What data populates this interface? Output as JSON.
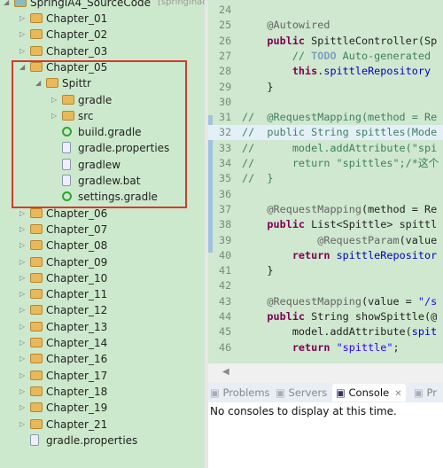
{
  "tree": {
    "root": "SpringIA4_SourceCode",
    "root_suffix": "[springinacti",
    "items": [
      {
        "label": "Chapter_01",
        "level": 1,
        "type": "folder",
        "state": "collapsed"
      },
      {
        "label": "Chapter_02",
        "level": 1,
        "type": "folder",
        "state": "collapsed"
      },
      {
        "label": "Chapter_03",
        "level": 1,
        "type": "folder",
        "state": "collapsed"
      },
      {
        "label": "Chapter_05",
        "level": 1,
        "type": "folder",
        "state": "expanded"
      },
      {
        "label": "Spittr",
        "level": 2,
        "type": "folder",
        "state": "expanded"
      },
      {
        "label": "gradle",
        "level": 3,
        "type": "folder",
        "state": "collapsed"
      },
      {
        "label": "src",
        "level": 3,
        "type": "folder",
        "state": "collapsed"
      },
      {
        "label": "build.gradle",
        "level": 3,
        "type": "gradle"
      },
      {
        "label": "gradle.properties",
        "level": 3,
        "type": "file"
      },
      {
        "label": "gradlew",
        "level": 3,
        "type": "file"
      },
      {
        "label": "gradlew.bat",
        "level": 3,
        "type": "file"
      },
      {
        "label": "settings.gradle",
        "level": 3,
        "type": "gradle"
      },
      {
        "label": "Chapter_06",
        "level": 1,
        "type": "folder",
        "state": "collapsed"
      },
      {
        "label": "Chapter_07",
        "level": 1,
        "type": "folder",
        "state": "collapsed"
      },
      {
        "label": "Chapter_08",
        "level": 1,
        "type": "folder",
        "state": "collapsed"
      },
      {
        "label": "Chapter_09",
        "level": 1,
        "type": "folder",
        "state": "collapsed"
      },
      {
        "label": "Chapter_10",
        "level": 1,
        "type": "folder",
        "state": "collapsed"
      },
      {
        "label": "Chapter_11",
        "level": 1,
        "type": "folder",
        "state": "collapsed"
      },
      {
        "label": "Chapter_12",
        "level": 1,
        "type": "folder",
        "state": "collapsed"
      },
      {
        "label": "Chapter_13",
        "level": 1,
        "type": "folder",
        "state": "collapsed"
      },
      {
        "label": "Chapter_14",
        "level": 1,
        "type": "folder",
        "state": "collapsed"
      },
      {
        "label": "Chapter_16",
        "level": 1,
        "type": "folder",
        "state": "collapsed"
      },
      {
        "label": "Chapter_17",
        "level": 1,
        "type": "folder",
        "state": "collapsed"
      },
      {
        "label": "Chapter_18",
        "level": 1,
        "type": "folder",
        "state": "collapsed"
      },
      {
        "label": "Chapter_19",
        "level": 1,
        "type": "folder",
        "state": "collapsed"
      },
      {
        "label": "Chapter_21",
        "level": 1,
        "type": "folder",
        "state": "collapsed"
      },
      {
        "label": "gradle.properties",
        "level": 1,
        "type": "file"
      }
    ]
  },
  "editor": {
    "lines": [
      {
        "n": "24",
        "html": ""
      },
      {
        "n": "25",
        "html": "    <span class='an'>@Autowired</span>"
      },
      {
        "n": "26",
        "html": "    <span class='kw'>public</span> SpittleController(Sp"
      },
      {
        "n": "27",
        "html": "        <span class='cm'>// <b style='color:#7f9fbf'>TODO</b> Auto-generated</span>"
      },
      {
        "n": "28",
        "html": "        <span class='kw'>this</span>.<span class='fd'>spittleRepository</span>"
      },
      {
        "n": "29",
        "html": "    }"
      },
      {
        "n": "30",
        "html": ""
      },
      {
        "n": "31",
        "html": "<span class='cm'>//  @RequestMapping(method = Re</span>"
      },
      {
        "n": "32",
        "html": "<span class='cm'>//  public String spittles(Mode</span>"
      },
      {
        "n": "33",
        "html": "<span class='cm'>//      model.addAttribute(\"spi</span>"
      },
      {
        "n": "34",
        "html": "<span class='cm'>//      return \"spittles\";/*这个</span>"
      },
      {
        "n": "35",
        "html": "<span class='cm'>//  }</span>"
      },
      {
        "n": "36",
        "html": ""
      },
      {
        "n": "37",
        "html": "    <span class='an'>@RequestMapping</span>(method = Re"
      },
      {
        "n": "38",
        "html": "    <span class='kw'>public</span> List&lt;Spittle&gt; spittl"
      },
      {
        "n": "39",
        "html": "            <span class='an'>@RequestParam</span>(value"
      },
      {
        "n": "40",
        "html": "        <span class='kw'>return</span> <span class='fd'>spittleRepositor</span>"
      },
      {
        "n": "41",
        "html": "    }"
      },
      {
        "n": "42",
        "html": ""
      },
      {
        "n": "43",
        "html": "    <span class='an'>@RequestMapping</span>(value = <span class='st'>\"/s</span>"
      },
      {
        "n": "44",
        "html": "    <span class='kw'>public</span> String showSpittle(@"
      },
      {
        "n": "45",
        "html": "        model.addAttribute(<span class='fd'>spit</span>"
      },
      {
        "n": "46",
        "html": "        <span class='kw'>return</span> <span class='st'>\"spittle\"</span>;"
      }
    ]
  },
  "panel": {
    "tabs": [
      {
        "label": "Problems",
        "icon": "problems-icon"
      },
      {
        "label": "Servers",
        "icon": "servers-icon"
      },
      {
        "label": "Console",
        "icon": "console-icon",
        "active": true
      },
      {
        "label": "Pr",
        "icon": "progress-icon"
      }
    ],
    "close_glyph": "✕",
    "message": "No consoles to display at this time."
  }
}
